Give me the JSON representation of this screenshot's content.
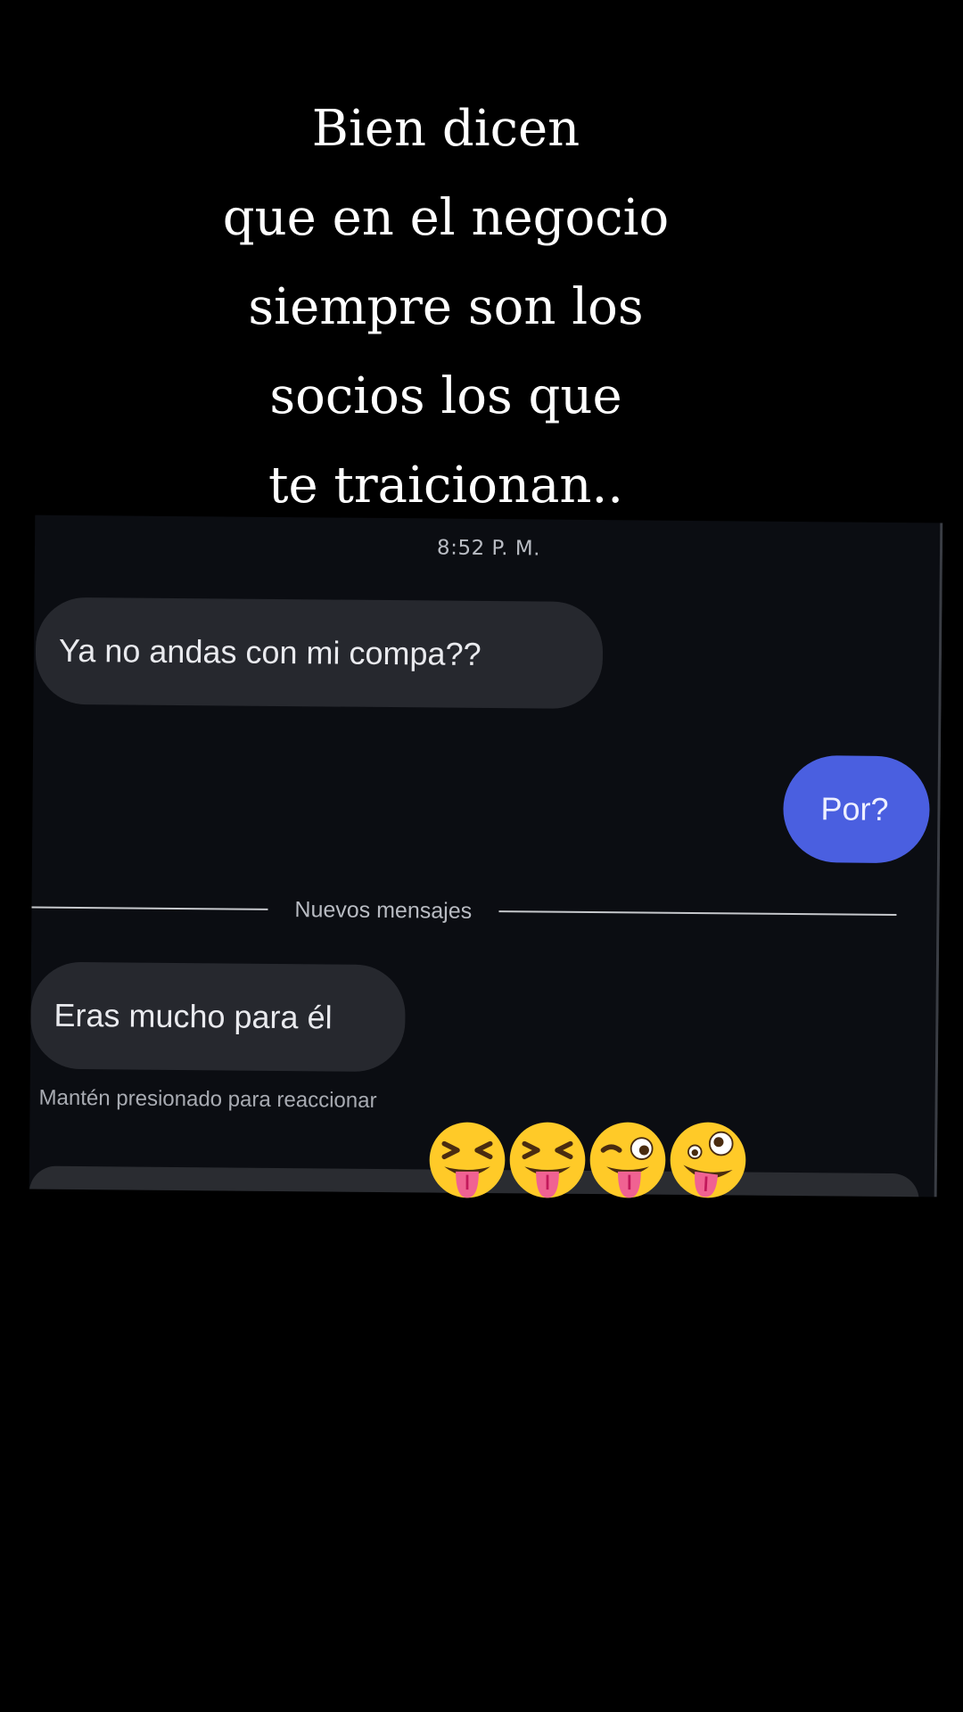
{
  "caption": {
    "lines": [
      "Bien dicen",
      "que en el negocio",
      "siempre son los",
      "socios los que",
      "te traicionan.."
    ]
  },
  "chat": {
    "timestamp": "8:52 P. M.",
    "messages": [
      {
        "direction": "incoming",
        "text": "Ya no andas con mi compa??"
      },
      {
        "direction": "outgoing",
        "text": "Por?"
      },
      {
        "direction": "incoming",
        "text": "Eras mucho para él"
      }
    ],
    "divider_label": "Nuevos mensajes",
    "hint": "Mantén presionado para reaccionar",
    "colors": {
      "background": "#0b0d12",
      "incoming_bubble": "#26282e",
      "outgoing_bubble": "#4a5fe0"
    }
  },
  "emojis": [
    {
      "icon": "squinting-face-with-tongue-icon",
      "char": "😝"
    },
    {
      "icon": "squinting-face-with-tongue-icon",
      "char": "😝"
    },
    {
      "icon": "winking-face-with-tongue-icon",
      "char": "😜"
    },
    {
      "icon": "zany-face-icon",
      "char": "🤪"
    }
  ]
}
